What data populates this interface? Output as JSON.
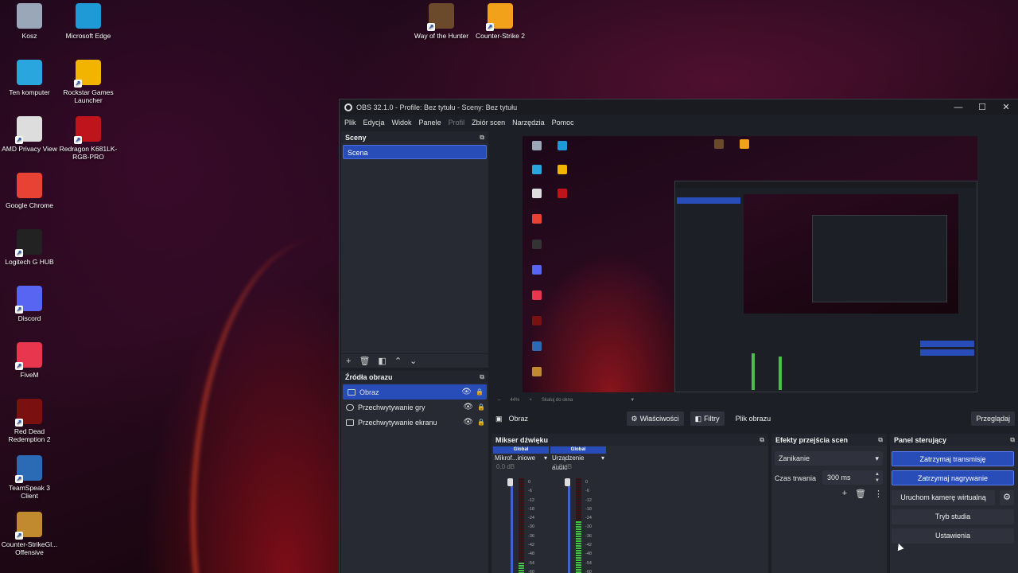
{
  "desktop": {
    "icons": [
      {
        "label": "Kosz",
        "icon": "recycle-bin-icon",
        "color": "#9aa7b8"
      },
      {
        "label": "Microsoft Edge",
        "icon": "edge-icon",
        "color": "#1f9ad6"
      },
      {
        "label": "Ten komputer",
        "icon": "computer-icon",
        "color": "#2aa6df"
      },
      {
        "label": "Rockstar Games Launcher",
        "icon": "rockstar-icon",
        "color": "#f3b400"
      },
      {
        "label": "AMD Privacy View",
        "icon": "amd-privacy-icon",
        "color": "#dddddd"
      },
      {
        "label": "Redragon K681LK-RGB-PRO",
        "icon": "redragon-icon",
        "color": "#c0141c"
      },
      {
        "label": "Google Chrome",
        "icon": "chrome-icon",
        "color": "#e84235"
      },
      {
        "label": "Logitech G HUB",
        "icon": "logitech-icon",
        "color": "#222222"
      },
      {
        "label": "Discord",
        "icon": "discord-icon",
        "color": "#5865f2"
      },
      {
        "label": "FiveM",
        "icon": "fivem-icon",
        "color": "#e8364f"
      },
      {
        "label": "Red Dead Redemption 2",
        "icon": "rdr2-icon",
        "color": "#7a1010"
      },
      {
        "label": "TeamSpeak 3 Client",
        "icon": "teamspeak-icon",
        "color": "#2b6bb5"
      },
      {
        "label": "Counter-StrikeGl... Offensive",
        "icon": "csgo-icon",
        "color": "#c28a2e"
      },
      {
        "label": "Way of the Hunter",
        "icon": "way-of-the-hunter-icon",
        "color": "#6b4a2b"
      },
      {
        "label": "Counter-Strike 2",
        "icon": "cs2-icon",
        "color": "#f2a21a"
      }
    ]
  },
  "obs": {
    "title": "OBS 32.1.0 - Profile: Bez tytułu - Sceny: Bez tytułu",
    "window_controls": {
      "minimize": "—",
      "maximize": "☐",
      "close": "✕"
    },
    "menu": [
      "Plik",
      "Edycja",
      "Widok",
      "Panele",
      "Profil",
      "Zbiór scen",
      "Narzędzia",
      "Pomoc"
    ],
    "scenes": {
      "title": "Sceny",
      "items": [
        "Scena"
      ]
    },
    "sources": {
      "title": "Źródła obrazu",
      "items": [
        {
          "label": "Obraz",
          "icon": "image-source-icon"
        },
        {
          "label": "Przechwytywanie gry",
          "icon": "game-capture-icon"
        },
        {
          "label": "Przechwytywanie ekranu",
          "icon": "display-capture-icon"
        }
      ]
    },
    "preview": {
      "zoom": "44%",
      "scale_label": "Skaluj do okna"
    },
    "context": {
      "source_name": "Obraz",
      "properties": "Właściwości",
      "filters": "Filtry",
      "file_label": "Plik obrazu",
      "browse": "Przeglądaj"
    },
    "mixer": {
      "title": "Mikser dźwięku",
      "channels": [
        {
          "group": "Global",
          "name": "Mikrof...iniowe",
          "db": "0.0 dB",
          "level": 0.12
        },
        {
          "group": "Global",
          "name": "Urządzenie audio",
          "db": "0.0 dB",
          "level": 0.55
        }
      ],
      "scale": [
        "0",
        "-6",
        "-12",
        "-18",
        "-24",
        "-30",
        "-36",
        "-42",
        "-48",
        "-54",
        "-60"
      ]
    },
    "transitions": {
      "title": "Efekty przejścia scen",
      "selected": "Zanikanie",
      "duration_label": "Czas trwania",
      "duration": "300 ms"
    },
    "controls": {
      "title": "Panel sterujący",
      "stop_stream": "Zatrzymaj transmisję",
      "stop_recording": "Zatrzymaj nagrywanie",
      "virtual_cam": "Uruchom kamerę wirtualną",
      "studio_mode": "Tryb studia",
      "settings": "Ustawienia"
    }
  }
}
